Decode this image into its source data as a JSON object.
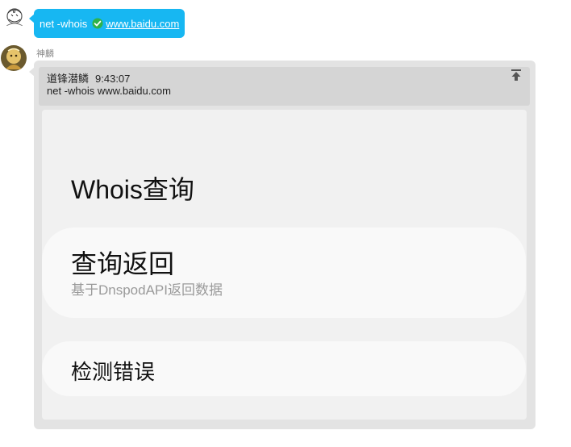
{
  "user_message": {
    "text": "net -whois",
    "link": "www.baidu.com",
    "check_icon": "check-circle-icon",
    "bubble_color": "#17b7f2"
  },
  "bot": {
    "name": "神麟",
    "quote": {
      "author": "道锋潜鳞",
      "time": "9:43:07",
      "text": "net -whois www.baidu.com",
      "pin_icon": "pin-top-icon"
    },
    "card": {
      "title": "Whois查询",
      "items": [
        {
          "title": "查询返回",
          "subtitle": "基于DnspodAPI返回数据"
        },
        {
          "title": "检测错误"
        }
      ]
    }
  }
}
